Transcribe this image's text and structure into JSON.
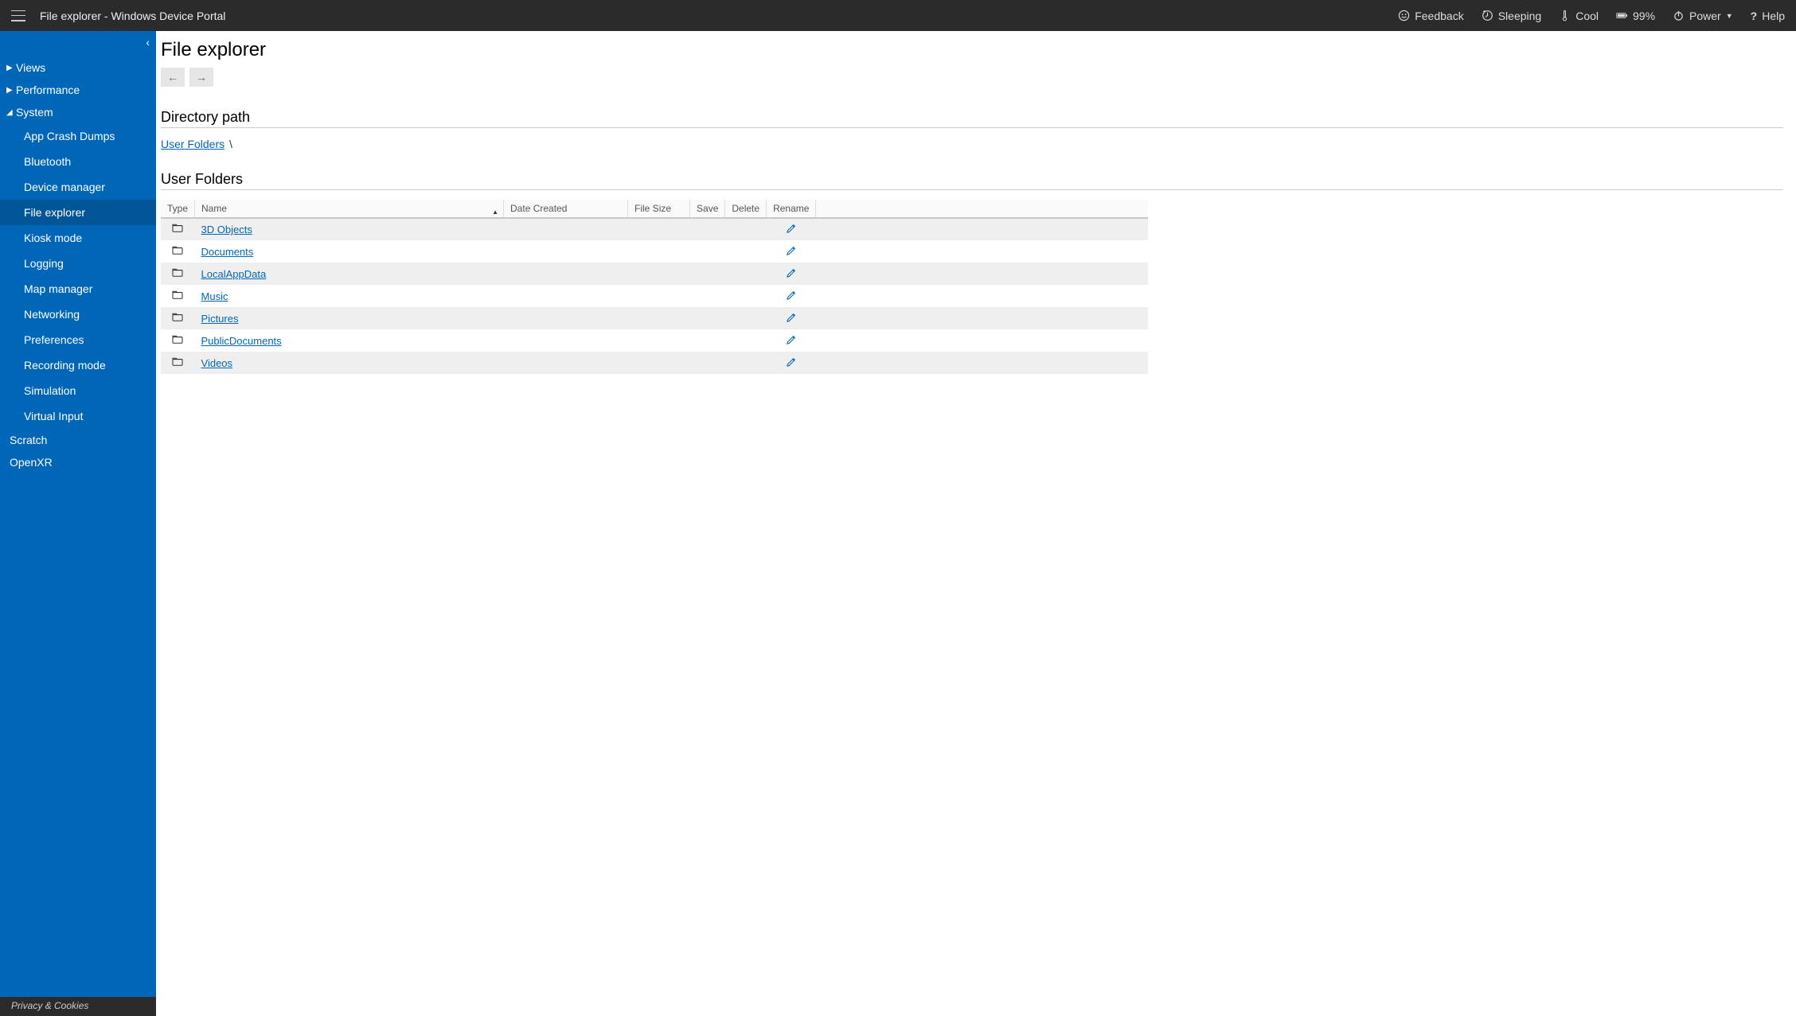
{
  "header": {
    "title": "File explorer - Windows Device Portal",
    "feedback": "Feedback",
    "sleeping": "Sleeping",
    "cool": "Cool",
    "battery": "99%",
    "power": "Power",
    "help": "Help"
  },
  "sidebar": {
    "collapse_glyph": "‹",
    "groups": [
      {
        "label": "Views",
        "expanded": false,
        "arrow": "▶"
      },
      {
        "label": "Performance",
        "expanded": false,
        "arrow": "▶"
      },
      {
        "label": "System",
        "expanded": true,
        "arrow": "◢",
        "children": [
          {
            "label": "App Crash Dumps",
            "active": false
          },
          {
            "label": "Bluetooth",
            "active": false
          },
          {
            "label": "Device manager",
            "active": false
          },
          {
            "label": "File explorer",
            "active": true
          },
          {
            "label": "Kiosk mode",
            "active": false
          },
          {
            "label": "Logging",
            "active": false
          },
          {
            "label": "Map manager",
            "active": false
          },
          {
            "label": "Networking",
            "active": false
          },
          {
            "label": "Preferences",
            "active": false
          },
          {
            "label": "Recording mode",
            "active": false
          },
          {
            "label": "Simulation",
            "active": false
          },
          {
            "label": "Virtual Input",
            "active": false
          }
        ]
      }
    ],
    "top_items": [
      {
        "label": "Scratch"
      },
      {
        "label": "OpenXR"
      }
    ],
    "footer": "Privacy & Cookies"
  },
  "page": {
    "title": "File explorer",
    "directory_path_heading": "Directory path",
    "breadcrumb_root": "User Folders",
    "breadcrumb_sep": "\\",
    "folder_heading": "User Folders",
    "columns": {
      "type": "Type",
      "name": "Name",
      "date": "Date Created",
      "size": "File Size",
      "save": "Save",
      "delete": "Delete",
      "rename": "Rename"
    },
    "rows": [
      {
        "name": "3D Objects"
      },
      {
        "name": "Documents"
      },
      {
        "name": "LocalAppData"
      },
      {
        "name": "Music"
      },
      {
        "name": "Pictures"
      },
      {
        "name": "PublicDocuments"
      },
      {
        "name": "Videos"
      }
    ]
  }
}
